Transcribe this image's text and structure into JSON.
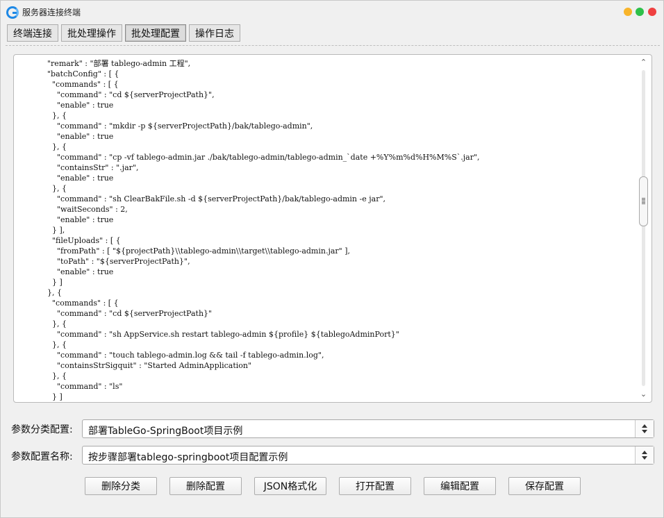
{
  "window": {
    "title": "服务器连接终端"
  },
  "tabs": [
    {
      "label": "终端连接",
      "active": false
    },
    {
      "label": "批处理操作",
      "active": false
    },
    {
      "label": "批处理配置",
      "active": true
    },
    {
      "label": "操作日志",
      "active": false
    }
  ],
  "editor": {
    "lines": [
      "  \"remark\" : \"部署 tablego-admin 工程\",",
      "  \"batchConfig\" : [ {",
      "    \"commands\" : [ {",
      "      \"command\" : \"cd ${serverProjectPath}\",",
      "      \"enable\" : true",
      "    }, {",
      "      \"command\" : \"mkdir -p ${serverProjectPath}/bak/tablego-admin\",",
      "      \"enable\" : true",
      "    }, {",
      "      \"command\" : \"cp -vf tablego-admin.jar ./bak/tablego-admin/tablego-admin_`date +%Y%m%d%H%M%S`.jar\",",
      "      \"containsStr\" : \".jar\",",
      "      \"enable\" : true",
      "    }, {",
      "      \"command\" : \"sh ClearBakFile.sh -d ${serverProjectPath}/bak/tablego-admin -e jar\",",
      "      \"waitSeconds\" : 2,",
      "      \"enable\" : true",
      "    } ],",
      "    \"fileUploads\" : [ {",
      "      \"fromPath\" : [ \"${projectPath}\\\\tablego-admin\\\\target\\\\tablego-admin.jar\" ],",
      "      \"toPath\" : \"${serverProjectPath}\",",
      "      \"enable\" : true",
      "    } ]",
      "  }, {",
      "    \"commands\" : [ {",
      "      \"command\" : \"cd ${serverProjectPath}\"",
      "    }, {",
      "      \"command\" : \"sh AppService.sh restart tablego-admin ${profile} ${tablegoAdminPort}\"",
      "    }, {",
      "      \"command\" : \"touch tablego-admin.log && tail -f tablego-admin.log\",",
      "      \"containsStrSigquit\" : \"Started AdminApplication\"",
      "    }, {",
      "      \"command\" : \"ls\"",
      "    } ]"
    ]
  },
  "form": {
    "category_label": "参数分类配置:",
    "category_value": "部署TableGo-SpringBoot项目示例",
    "config_name_label": "参数配置名称:",
    "config_name_value": "按步骤部署tablego-springboot项目配置示例"
  },
  "buttons": {
    "delete_category": "删除分类",
    "delete_config": "删除配置",
    "json_format": "JSON格式化",
    "open_config": "打开配置",
    "edit_config": "编辑配置",
    "save_config": "保存配置"
  }
}
